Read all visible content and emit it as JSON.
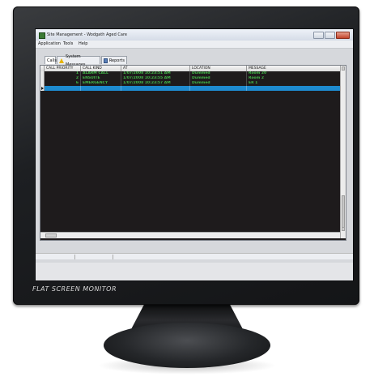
{
  "monitor": {
    "label": "FLAT SCREEN MONITOR"
  },
  "window": {
    "title": "Site Management - Wodgath Aged Care"
  },
  "menu": [
    "Application",
    "Tools",
    "Help"
  ],
  "tabs": [
    {
      "label": "Calls",
      "icon": "none"
    },
    {
      "label": "System Messages",
      "icon": "warning-icon"
    },
    {
      "label": "Reports",
      "icon": "report-icon"
    }
  ],
  "grid": {
    "columns": [
      "CALL PRIORITY",
      "CALL KIND",
      "AT",
      "LOCATION",
      "MESSAGE"
    ],
    "rows": [
      {
        "priority": "1",
        "kind": "ALARM CALL",
        "at": "1/07/2008 10:23:51 AM",
        "location": "Dummed",
        "message": "Room 20"
      },
      {
        "priority": "2",
        "kind": "ENSUITE",
        "at": "1/07/2008 10:23:55 AM",
        "location": "Dummed",
        "message": "Room 2"
      },
      {
        "priority": "6",
        "kind": "EMERGENCY",
        "at": "1/07/2008 10:23:57 AM",
        "location": "Dummed",
        "message": "ER 1"
      },
      {
        "priority": "",
        "kind": "",
        "at": "",
        "location": "",
        "message": ""
      }
    ]
  },
  "colors": {
    "row_text": "#42b548",
    "selected_row": "#1e8bcf",
    "grid_background": "#1e1b1c"
  }
}
